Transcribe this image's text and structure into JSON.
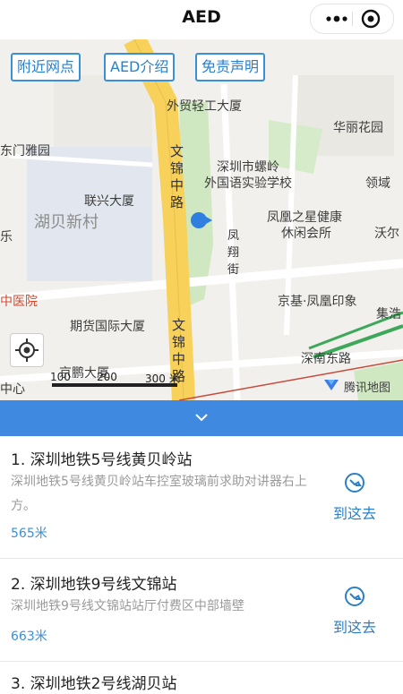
{
  "header": {
    "title": "AED",
    "more_icon": "more-dots-icon",
    "close_icon": "close-circle-icon"
  },
  "map": {
    "tabs": [
      "附近网点",
      "AED介绍",
      "免责声明"
    ],
    "labels": {
      "waimao": "外贸轻工大厦",
      "huli": "华丽花园",
      "dongmen": "东门雅园",
      "lingyu": "领域",
      "school1": "深圳市螺岭",
      "school2": "外国语实验学校",
      "lianxing": "联兴大厦",
      "hubei": "湖贝新村",
      "fenghuang1": "凤凰之星健康",
      "fenghuang2": "休闲会所",
      "wowo": "沃尔",
      "hospital": "中医院",
      "le": "乐",
      "jingji": "京基·凤凰印象",
      "jijie": "集浩",
      "qihuo": "期货国际大厦",
      "shennan": "深南东路",
      "jingpeng": "京鹏大厦",
      "zhongxin": "中心",
      "wenjin1": "文锦中路",
      "wenjin2": "文锦中路",
      "fengxiang": "凤翔街"
    },
    "scale_labels": [
      "100",
      "200",
      "300 米"
    ],
    "attribution": "腾讯地图",
    "locate_icon": "locate-crosshair-icon",
    "current_location_icon": "current-location-dot-icon"
  },
  "collapse_icon": "chevron-down-icon",
  "list": {
    "items": [
      {
        "title": "1. 深圳地铁5号线黄贝岭站",
        "desc": "深圳地铁5号线黄贝岭站车控室玻璃前求助对讲器右上方。",
        "distance": "565米",
        "go_label": "到这去"
      },
      {
        "title": "2. 深圳地铁9号线文锦站",
        "desc": "深圳地铁9号线文锦站站厅付费区中部墙壁",
        "distance": "663米",
        "go_label": "到这去"
      },
      {
        "title": "3. 深圳地铁2号线湖贝站",
        "desc": "",
        "distance": "",
        "go_label": ""
      }
    ]
  },
  "colors": {
    "accent": "#3f8ae0",
    "link": "#2a7fc9",
    "road_yellow": "#f7d15a",
    "park_green": "#cfe8c2"
  }
}
